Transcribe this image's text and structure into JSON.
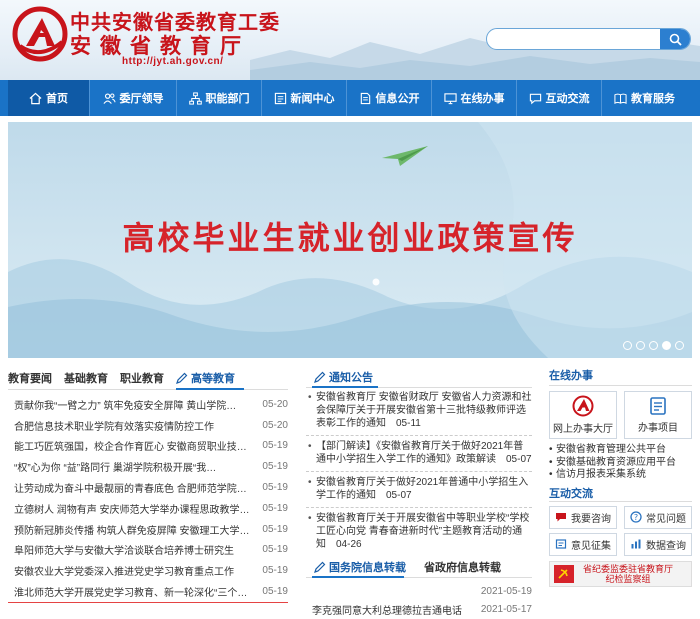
{
  "header": {
    "title_line1": "中共安徽省委教育工委",
    "title_line2": "安徽省教育厅",
    "url": "http://jyt.ah.gov.cn/",
    "search_placeholder": ""
  },
  "nav": {
    "items": [
      {
        "label": "首页",
        "icon": "home-icon"
      },
      {
        "label": "委厅领导",
        "icon": "users-icon"
      },
      {
        "label": "职能部门",
        "icon": "org-chart-icon"
      },
      {
        "label": "新闻中心",
        "icon": "news-icon"
      },
      {
        "label": "信息公开",
        "icon": "document-icon"
      },
      {
        "label": "在线办事",
        "icon": "monitor-icon"
      },
      {
        "label": "互动交流",
        "icon": "chat-icon"
      },
      {
        "label": "教育服务",
        "icon": "book-icon"
      }
    ]
  },
  "banner": {
    "headline": "高校毕业生就业创业政策宣传"
  },
  "news": {
    "tabs": [
      "教育要闻",
      "基础教育",
      "职业教育",
      "高等教育"
    ],
    "items": [
      {
        "title": "贡献你我“一臂之力” 筑牢免疫安全屏障 黄山学院…",
        "date": "05-20"
      },
      {
        "title": "合肥信息技术职业学院有效落实疫情防控工作",
        "date": "05-20"
      },
      {
        "title": "能工巧匠筑强国，校企合作育匠心 安徽商贸职业技术…",
        "date": "05-19"
      },
      {
        "title": "“权”心为你 “益”路同行 巢湖学院积极开展“我…",
        "date": "05-19"
      },
      {
        "title": "让劳动成为奋斗中最靓丽的青春底色 合肥师范学院全…",
        "date": "05-19"
      },
      {
        "title": "立德树人 润物有声 安庆师范大学举办课程思政教学…",
        "date": "05-19"
      },
      {
        "title": "预防新冠肺炎传播 构筑人群免疫屏障 安徽理工大学…",
        "date": "05-19"
      },
      {
        "title": "阜阳师范大学与安徽大学洽谈联合培养博士研究生",
        "date": "05-19"
      },
      {
        "title": "安徽农业大学党委深入推进党史学习教育重点工作",
        "date": "05-19"
      },
      {
        "title": "淮北师范大学开展党史学习教育、新一轮深化“三个…",
        "date": "05-19"
      }
    ]
  },
  "notices": {
    "heading": "通知公告",
    "items": [
      "安徽省教育厅 安徽省财政厅 安徽省人力资源和社会保障厅关于开展安徽省第十三批特级教师评选表彰工作的通知　05-11",
      "【部门解读】《安徽省教育厅关于做好2021年普通中小学招生入学工作的通知》政策解读　05-07",
      "安徽省教育厅关于做好2021年普通中小学招生入学工作的通知　05-07",
      "安徽省教育厅关于开展安徽省中等职业学校“学校工匠心向党 青春奋进新时代”主题教育活动的通知　04-26"
    ]
  },
  "policy": {
    "tab_active": "国务院信息转载",
    "tab_other": "省政府信息转载",
    "items": [
      {
        "title": "",
        "date": "2021-05-19"
      },
      {
        "title": "李克强同意大利总理德拉吉通电话",
        "date": "2021-05-17"
      }
    ]
  },
  "online": {
    "heading": "在线办事",
    "btn_hall": "网上办事大厅",
    "btn_items": "办事项目",
    "links": [
      "安徽省教育管理公共平台",
      "安徽基础教育资源应用平台",
      "信访月报表采集系统"
    ]
  },
  "interact": {
    "heading": "互动交流",
    "buttons": [
      {
        "label": "我要咨询",
        "icon": "consult-icon"
      },
      {
        "label": "常见问题",
        "icon": "question-icon"
      },
      {
        "label": "意见征集",
        "icon": "feedback-icon"
      },
      {
        "label": "数据查询",
        "icon": "chart-icon"
      }
    ],
    "inspect_line1": "省纪委监委驻省教育厅",
    "inspect_line2": "纪检监察组"
  },
  "colors": {
    "brand_red": "#c8141b",
    "nav_blue": "#1a73c7",
    "nav_active": "#0f5aa6",
    "banner_bg": "#cfe3ef"
  }
}
